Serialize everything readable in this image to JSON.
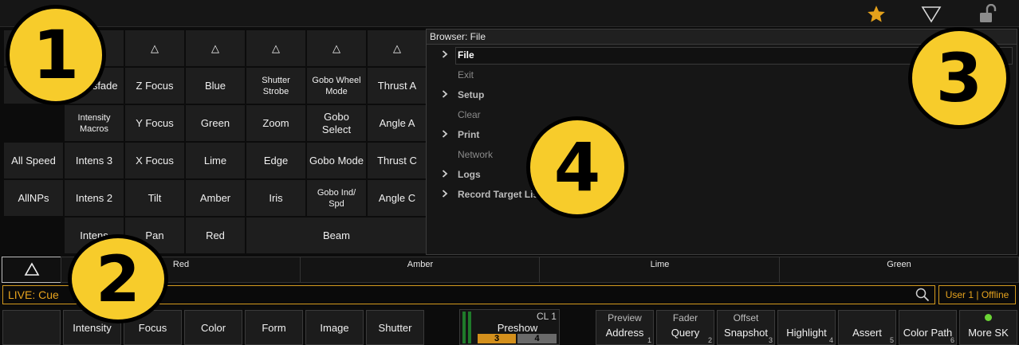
{
  "topbar": {
    "icons": [
      "star-icon",
      "filter-icon",
      "unlock-icon"
    ]
  },
  "grid": {
    "rows": [
      [
        "",
        "△",
        "△",
        "△",
        "△",
        "△",
        "△"
      ],
      [
        "",
        "Crossfade",
        "Z Focus",
        "Blue",
        "Shutter Strobe",
        "Gobo Wheel Mode",
        "Thrust A"
      ],
      [
        "",
        "Intensity Macros",
        "Y Focus",
        "Green",
        "Zoom",
        "Gobo Select",
        "Angle A"
      ],
      [
        "All Speed",
        "Intens 3",
        "X Focus",
        "Lime",
        "Edge",
        "Gobo Mode",
        "Thrust C"
      ],
      [
        "AllNPs",
        "Intens 2",
        "Tilt",
        "Amber",
        "Iris",
        "Gobo Ind/ Spd",
        "Angle C"
      ],
      [
        "",
        "Intens",
        "Pan",
        "Red",
        "Beam"
      ]
    ]
  },
  "browser": {
    "title": "Browser: File",
    "items": [
      {
        "label": "File",
        "chevron": true,
        "style": "sel"
      },
      {
        "label": "Exit",
        "chevron": false,
        "style": "dim"
      },
      {
        "label": "Setup",
        "chevron": true,
        "style": "bold"
      },
      {
        "label": "Clear",
        "chevron": false,
        "style": "dim"
      },
      {
        "label": "Print",
        "chevron": true,
        "style": "bold"
      },
      {
        "label": "Network",
        "chevron": false,
        "style": "dim"
      },
      {
        "label": "Logs",
        "chevron": true,
        "style": "bold"
      },
      {
        "label": "Record Target List",
        "chevron": true,
        "style": "bold"
      }
    ]
  },
  "strip": {
    "up_arrow": "△",
    "labels": [
      "Red",
      "Amber",
      "Lime",
      "Green"
    ]
  },
  "command_line": {
    "text": "LIVE: Cue"
  },
  "user_status": "User 1 | Offline",
  "bottom_left_keys": [
    "",
    "Intensity",
    "Focus",
    "Color",
    "Form",
    "Image",
    "Shutter"
  ],
  "playback": {
    "cue_list": "CL 1",
    "label": "Preshow",
    "cue_a": "3",
    "cue_b": "4"
  },
  "softkeys": [
    {
      "sub": "Preview",
      "main": "Address",
      "num": "1"
    },
    {
      "sub": "Fader",
      "main": "Query",
      "num": "2"
    },
    {
      "sub": "Offset",
      "main": "Snapshot",
      "num": "3"
    },
    {
      "sub": "",
      "main": "Highlight",
      "num": "4"
    },
    {
      "sub": "",
      "main": "Assert",
      "num": "5"
    },
    {
      "sub": "",
      "main": "Color Path",
      "num": "6"
    },
    {
      "sub": "",
      "main": "More SK",
      "num": ""
    }
  ],
  "callouts": [
    "1",
    "2",
    "3",
    "4"
  ],
  "colors": {
    "accent": "#f7cc2b",
    "command": "#e6a31e",
    "star": "#e4a11b"
  }
}
